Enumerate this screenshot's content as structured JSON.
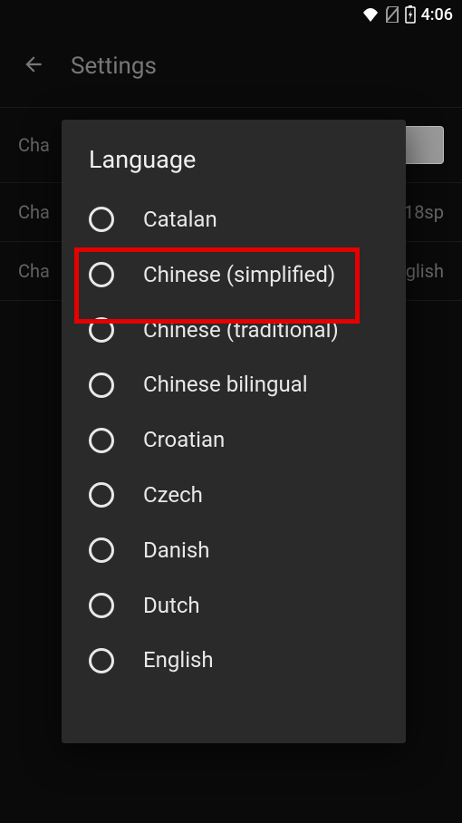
{
  "statusbar": {
    "time": "4:06"
  },
  "background": {
    "title": "Settings",
    "row1_left": "Cha",
    "row2_left": "Cha",
    "row2_right": "18sp",
    "row3_left": "Cha",
    "row3_right": "glish"
  },
  "dialog": {
    "title": "Language",
    "options": [
      "Catalan",
      "Chinese (simplified)",
      "Chinese (traditional)",
      "Chinese bilingual",
      "Croatian",
      "Czech",
      "Danish",
      "Dutch",
      "English"
    ]
  }
}
